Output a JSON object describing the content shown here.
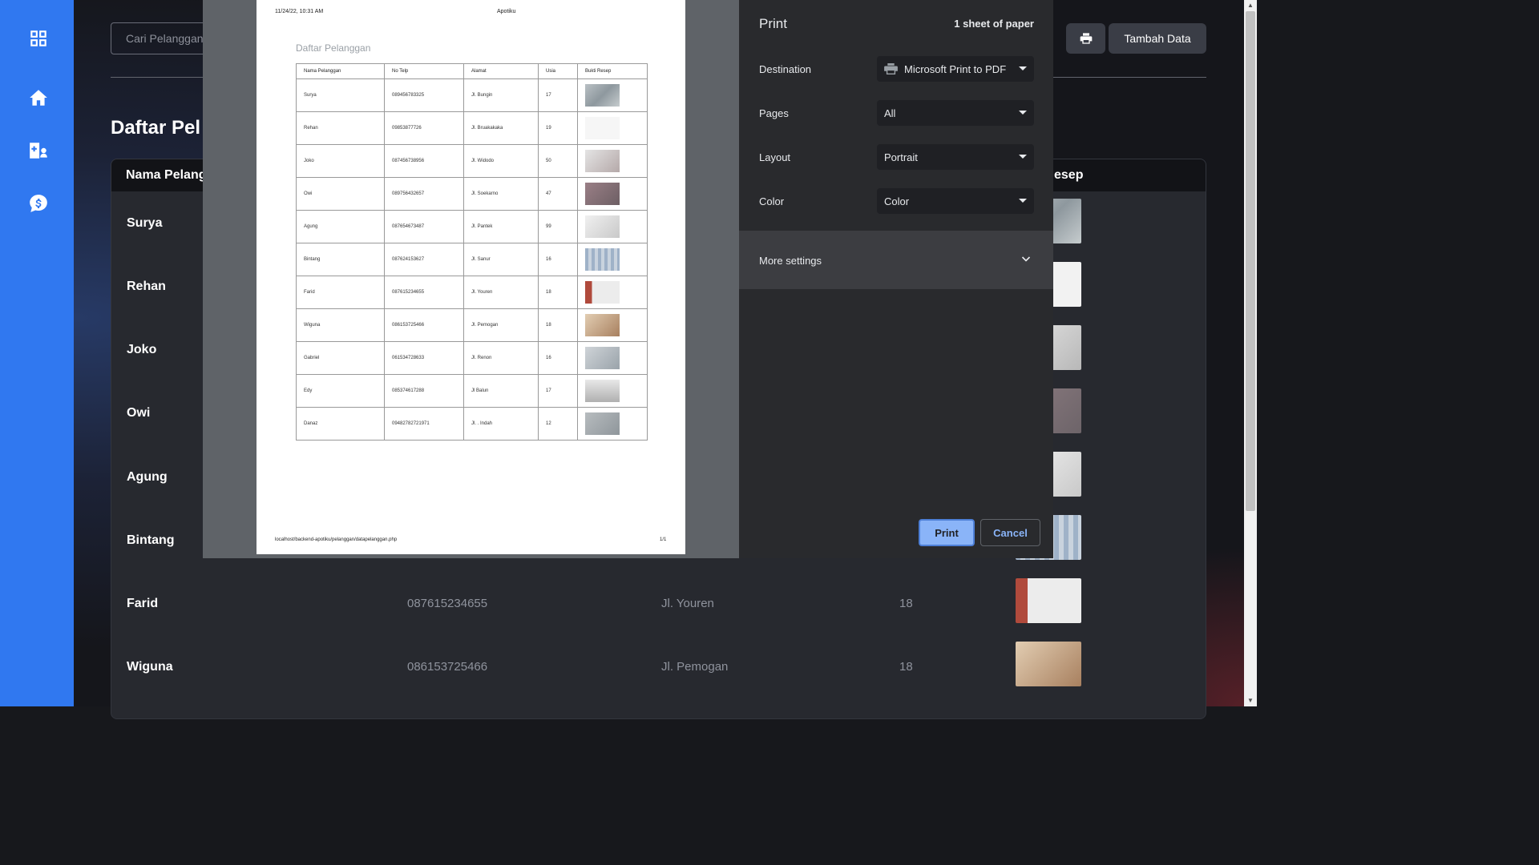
{
  "sidebar": {
    "icons": [
      "dashboard-grid-icon",
      "home-icon",
      "hospital-user-icon",
      "money-chat-icon"
    ]
  },
  "app": {
    "search_placeholder": "Cari Pelanggan",
    "page_title": "Daftar Pel",
    "add_button": "Tambah Data",
    "table_headers": {
      "name": "Nama Pelang",
      "receipt": "esep"
    },
    "rows": [
      {
        "name": "Surya"
      },
      {
        "name": "Rehan"
      },
      {
        "name": "Joko"
      },
      {
        "name": "Owi"
      },
      {
        "name": "Agung"
      },
      {
        "name": "Bintang"
      },
      {
        "name": "Farid",
        "phone": "087615234655",
        "address": "Jl. Youren",
        "age": "18"
      },
      {
        "name": "Wiguna",
        "phone": "086153725466",
        "address": "Jl. Pemogan",
        "age": "18"
      }
    ]
  },
  "preview": {
    "header_left": "11/24/22, 10:31 AM",
    "header_center": "Apotiku",
    "title": "Daftar Pelanggan",
    "columns": [
      "Nama Pelanggan",
      "No Telp",
      "Alamat",
      "Usia",
      "Bukti Resep"
    ],
    "rows": [
      [
        "Surya",
        "089456783325",
        "Jl. Bungin",
        "17"
      ],
      [
        "Rehan",
        "09853877726",
        "Jl. Bruakakaka",
        "19"
      ],
      [
        "Joko",
        "087456738956",
        "Jl. Widodo",
        "50"
      ],
      [
        "Owi",
        "089756432657",
        "Jl. Soekarno",
        "47"
      ],
      [
        "Agung",
        "087654673487",
        "Jl. Pantek",
        "99"
      ],
      [
        "Bintang",
        "087624153627",
        "Jl. Sanur",
        "16"
      ],
      [
        "Farid",
        "087615234655",
        "Jl. Youren",
        "18"
      ],
      [
        "Wiguna",
        "086153725466",
        "Jl. Pemogan",
        "18"
      ],
      [
        "Gabriel",
        "061534728633",
        "Jl. Renon",
        "16"
      ],
      [
        "Edy",
        "085374617288",
        "Jl Balun",
        "17"
      ],
      [
        "Danaz",
        "09482782721971",
        "Jl. . Indah",
        "12"
      ]
    ],
    "footer_left": "localhost/backend-apotiku/pelanggan/datapelanggan.php",
    "footer_right": "1/1"
  },
  "print_settings": {
    "title": "Print",
    "sheets": "1 sheet of paper",
    "destination_label": "Destination",
    "destination_value": "Microsoft Print to PDF",
    "pages_label": "Pages",
    "pages_value": "All",
    "layout_label": "Layout",
    "layout_value": "Portrait",
    "color_label": "Color",
    "color_value": "Color",
    "more_settings": "More settings",
    "print_button": "Print",
    "cancel_button": "Cancel"
  },
  "colors": {
    "sidebar": "#3078f0",
    "primary_button": "#8ab4f8",
    "dialog_bg": "#292a2d"
  }
}
